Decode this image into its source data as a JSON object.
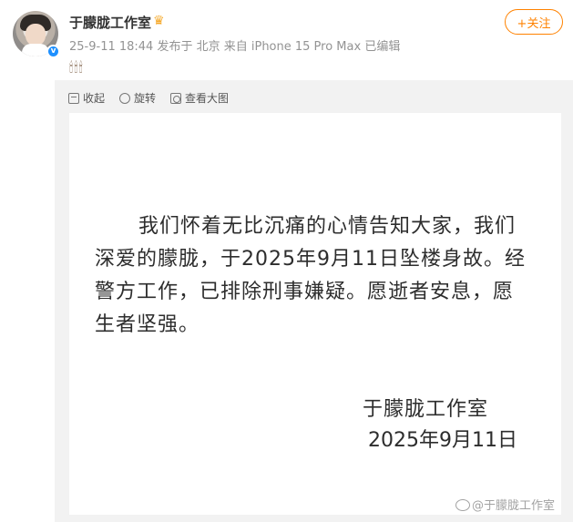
{
  "post": {
    "author": "于朦胧工作室",
    "meta": "25-9-11 18:44 发布于 北京 来自 iPhone 15 Pro Max 已编辑",
    "emojis": "🕯🕯🕯",
    "follow_label": "+关注",
    "verified_badge": "v"
  },
  "image_toolbar": [
    {
      "icon": "collapse-icon",
      "label": "收起"
    },
    {
      "icon": "rotate-icon",
      "label": "旋转"
    },
    {
      "icon": "view-large-icon",
      "label": "查看大图"
    }
  ],
  "notice": {
    "body": "我们怀着无比沉痛的心情告知大家，我们深爱的朦胧，于2025年9月11日坠楼身故。经警方工作，已排除刑事嫌疑。愿逝者安息，愿生者坚强。",
    "signature": "于朦胧工作室",
    "date": "2025年9月11日",
    "watermark": "@于朦胧工作室"
  },
  "colors": {
    "accent": "#ff8200",
    "verified": "#1e90ff",
    "panel_bg": "#f2f2f2"
  }
}
